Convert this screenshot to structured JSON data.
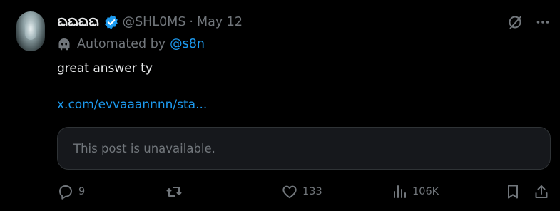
{
  "post": {
    "display_name": "ᨳᨳᨳᨳ",
    "handle": "@SHL0MS",
    "separator": "·",
    "date": "May 12",
    "automated_label": "Automated by",
    "automated_user": "@s8n",
    "text": "great answer ty",
    "link": "x.com/evvaaannnn/sta...",
    "quote_unavailable": "This post is unavailable."
  },
  "actions": {
    "reply_count": "9",
    "repost_count": "",
    "like_count": "133",
    "views_count": "106K"
  },
  "icons": {
    "verified": "verified-badge-icon",
    "grok": "grok-icon",
    "more": "more-icon",
    "bot": "bot-icon",
    "reply": "reply-icon",
    "repost": "repost-icon",
    "like": "heart-icon",
    "views": "views-icon",
    "bookmark": "bookmark-icon",
    "share": "share-icon"
  },
  "colors": {
    "background": "#000000",
    "text": "#e7e9ea",
    "muted": "#71767b",
    "accent": "#1d9bf0",
    "card": "#16181c"
  }
}
